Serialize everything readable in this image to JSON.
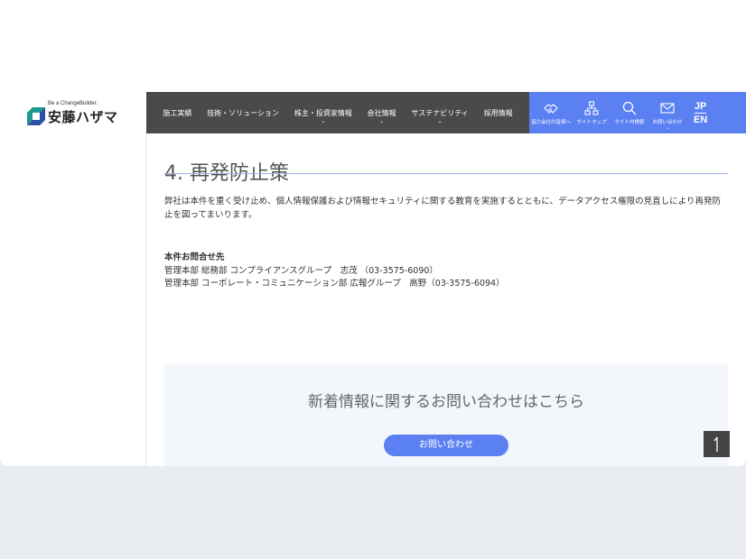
{
  "logo": {
    "tagline": "Be a ChangeBuilder.",
    "name": "安藤ハザマ"
  },
  "nav": {
    "items": [
      {
        "label": "施工実績",
        "has_dropdown": false
      },
      {
        "label": "技術・ソリューション",
        "has_dropdown": false
      },
      {
        "label": "株主・投資家情報",
        "has_dropdown": true
      },
      {
        "label": "会社情報",
        "has_dropdown": true
      },
      {
        "label": "サステナビリティ",
        "has_dropdown": true
      },
      {
        "label": "採用情報",
        "has_dropdown": false
      }
    ],
    "chevron": "⌄"
  },
  "utility": {
    "partners_label": "協力会社の皆様へ",
    "sitemap_label": "サイトマップ",
    "search_label": "サイト内検索",
    "contact_label": "お問い合わせ",
    "lang_jp": "JP",
    "lang_en": "EN",
    "bar_color": "#5b80f2",
    "icons": [
      "handshake-icon",
      "sitemap-icon",
      "search-icon",
      "mail-icon"
    ]
  },
  "section": {
    "title": "4. 再発防止策",
    "body": "弊社は本件を重く受け止め、個人情報保護および情報セキュリティに関する教育を実施するとともに、データアクセス権限の見直しにより再発防止を図ってまいります。"
  },
  "contact": {
    "heading": "本件お問合せ先",
    "line1": "管理本部 総務部 コンプライアンスグループ　志茂 （03-3575-6090）",
    "line2": "管理本部 コーポレート・コミュニケーション部 広報グループ　高野（03-3575-6094）"
  },
  "inquiry": {
    "title": "新着情報に関するお問い合わせはこちら",
    "button_label": "お問い合わせ"
  },
  "back_to_top": {
    "icon": "arrow-up-icon"
  }
}
